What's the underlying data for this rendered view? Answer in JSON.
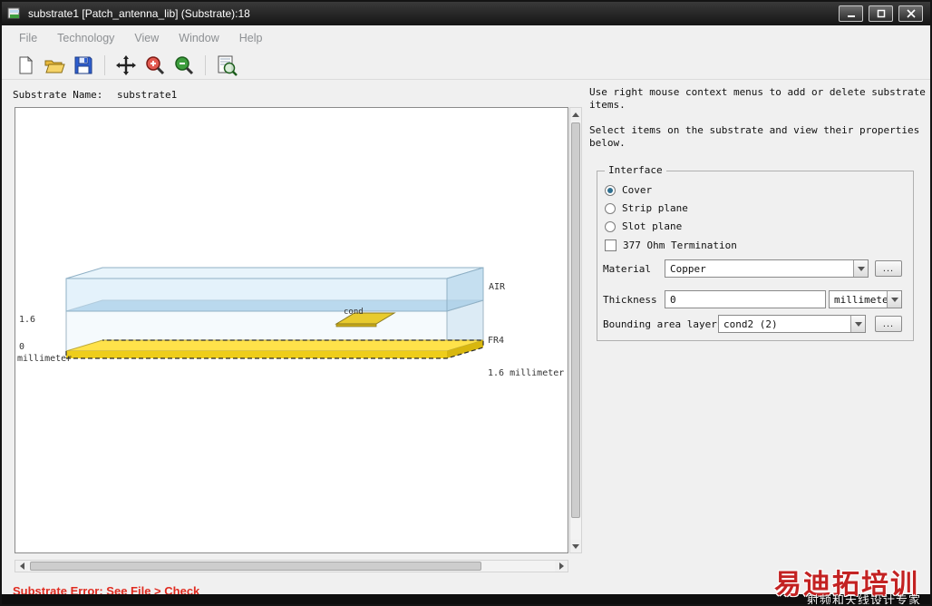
{
  "window": {
    "title": "substrate1 [Patch_antenna_lib] (Substrate):18"
  },
  "menu": {
    "items": [
      {
        "label": "File"
      },
      {
        "label": "Technology"
      },
      {
        "label": "View"
      },
      {
        "label": "Window"
      },
      {
        "label": "Help"
      }
    ]
  },
  "toolbar": {
    "buttons": [
      {
        "name": "new-file-icon"
      },
      {
        "name": "open-folder-icon"
      },
      {
        "name": "save-icon"
      },
      {
        "name": "pan-icon"
      },
      {
        "name": "zoom-in-icon"
      },
      {
        "name": "zoom-out-icon"
      },
      {
        "name": "zoom-fit-icon"
      }
    ]
  },
  "main": {
    "substrate_name_label": "Substrate Name:",
    "substrate_name_value": "substrate1",
    "canvas_labels": {
      "air": "AIR",
      "fr4_name": "FR4",
      "fr4_thickness": "1.6 millimeter",
      "cond": "cond",
      "dim_top": "1.6",
      "dim_zero": "0",
      "dim_unit": "millimeter"
    }
  },
  "right_panel": {
    "help1": "Use right mouse context menus to add or delete substrate items.",
    "help2": "Select items on the substrate and view their properties below.",
    "group_title": "Interface",
    "radios": [
      {
        "label": "Cover",
        "selected": true
      },
      {
        "label": "Strip plane",
        "selected": false
      },
      {
        "label": "Slot plane",
        "selected": false
      }
    ],
    "termination_checkbox": {
      "label": "377 Ohm Termination",
      "checked": false
    },
    "material": {
      "label": "Material",
      "value": "Copper",
      "browse_label": "..."
    },
    "thickness": {
      "label": "Thickness",
      "value": "0",
      "unit": "millimeter"
    },
    "bounding": {
      "label": "Bounding area layer:",
      "value": "cond2 (2)",
      "browse_label": "..."
    }
  },
  "status": {
    "error_text": "Substrate Error: See File > Check"
  },
  "watermark": {
    "title": "易迪拓培训",
    "subtitle": "射频和天线设计专家"
  },
  "colors": {
    "air_blue": "#cde7f7",
    "fr4_band": "#a3c8e2",
    "conductor_yellow": "#ffe24a",
    "error_red": "#e02b20"
  }
}
